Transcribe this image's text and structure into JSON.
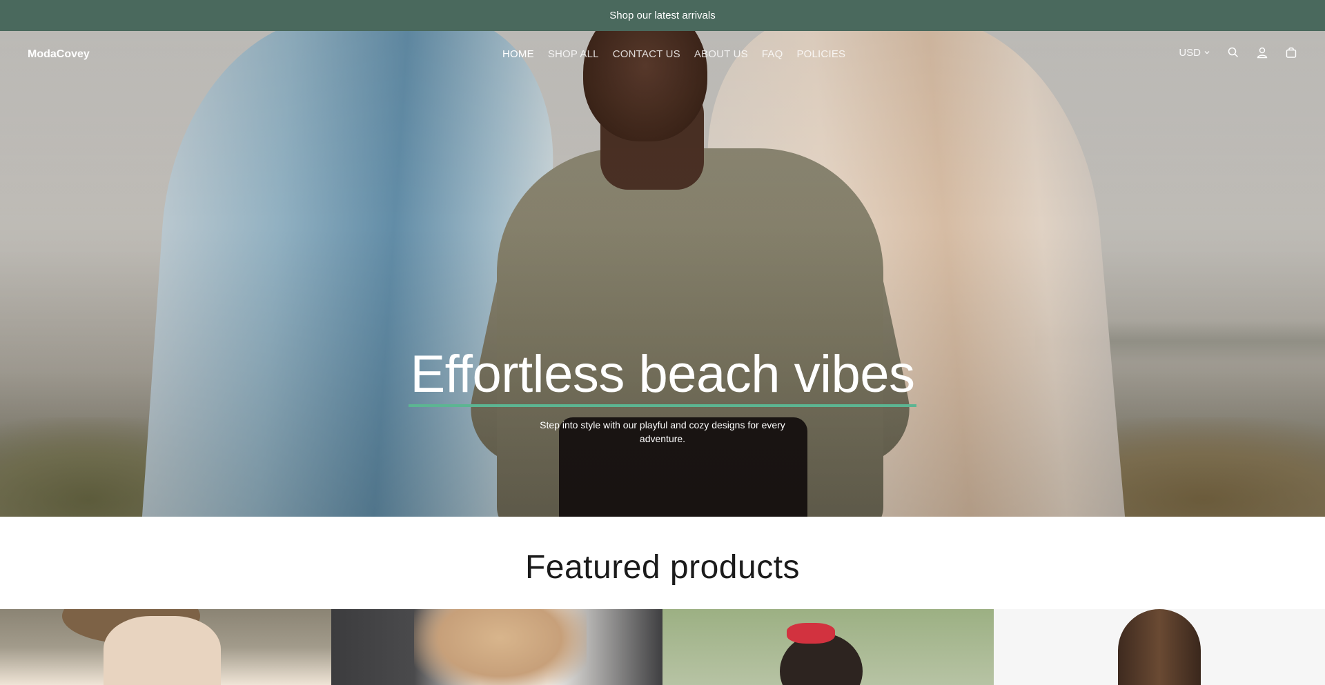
{
  "announcement": {
    "text": "Shop our latest arrivals"
  },
  "header": {
    "logo": "ModaCovey",
    "nav": [
      {
        "label": "HOME",
        "active": true
      },
      {
        "label": "SHOP ALL",
        "active": false
      },
      {
        "label": "CONTACT US",
        "active": false
      },
      {
        "label": "ABOUT US",
        "active": false
      },
      {
        "label": "FAQ",
        "active": false
      },
      {
        "label": "POLICIES",
        "active": false
      }
    ],
    "currency": "USD",
    "icons": [
      "chevron-down-icon",
      "search-icon",
      "account-icon",
      "cart-icon"
    ]
  },
  "hero": {
    "title": "Effortless beach vibes",
    "subtitle": "Step into style with our playful and cozy designs for every adventure."
  },
  "featured": {
    "title": "Featured products",
    "products": [
      {
        "name": ""
      },
      {
        "name": ""
      },
      {
        "name": ""
      },
      {
        "name": ""
      }
    ]
  },
  "colors": {
    "announcement_bg": "#4a695d",
    "accent_underline": "#5cb592",
    "text_dark": "#1b1b1b"
  }
}
